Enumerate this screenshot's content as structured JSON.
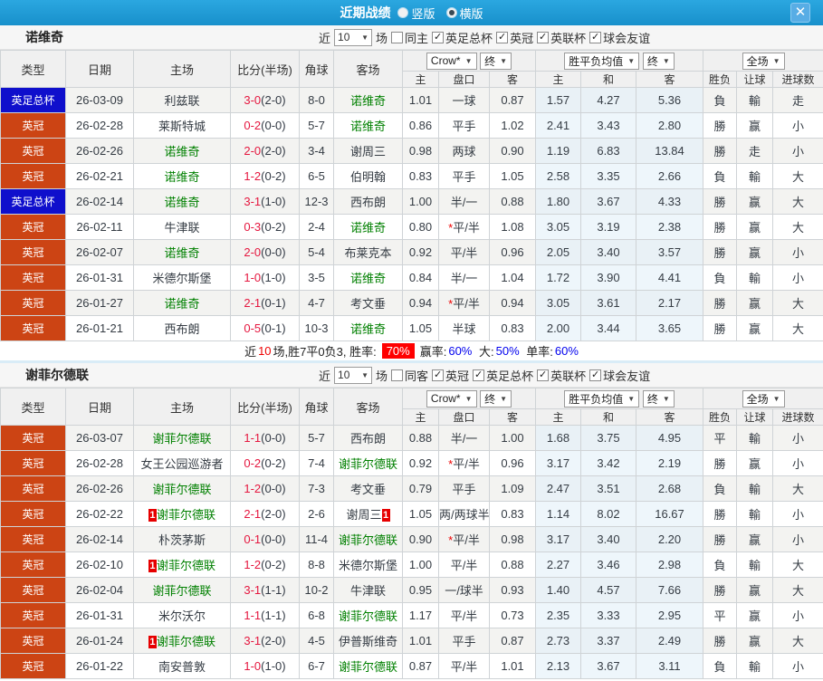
{
  "icons": {
    "dropdown_arrow": "▼",
    "close": "✕",
    "check": "✓"
  },
  "titlebar": {
    "title": "近期战绩",
    "radio_vertical": "竖版",
    "radio_horizontal": "横版"
  },
  "table_header": {
    "type": "类型",
    "date": "日期",
    "home": "主场",
    "score": "比分(半场)",
    "corner": "角球",
    "away": "客场",
    "h_home": "主",
    "h_handicap": "盘口",
    "h_away": "客",
    "o_home": "主",
    "o_draw": "和",
    "o_away": "客",
    "res_wl": "胜负",
    "res_handicap": "让球",
    "res_goals": "进球数"
  },
  "sections": [
    {
      "team": "诺维奇",
      "filter": {
        "near": "近",
        "count": "10",
        "games": "场",
        "same": "同主",
        "comps": [
          "英足总杯",
          "英冠",
          "英联杯",
          "球会友谊"
        ]
      },
      "dropdowns": {
        "book": "Crow*",
        "final1": "终",
        "avg": "胜平负均值",
        "final2": "终",
        "scope": "全场"
      },
      "rows": [
        {
          "type": "英足总杯",
          "tc": "cup",
          "date": "26-03-09",
          "hcard": "",
          "home": "利兹联",
          "hcls": "plain",
          "score": "3-0",
          "half": "(2-0)",
          "corner": "8-0",
          "away": "诺维奇",
          "acls": "team",
          "acard": "",
          "hw": "1.01",
          "star": "",
          "hd": "一球",
          "ha": "0.87",
          "oh": "1.57",
          "od": "4.27",
          "oa": "5.36",
          "r1": "負",
          "c1": "g",
          "r2": "輸",
          "c2": "g",
          "r3": "走",
          "c3": "b"
        },
        {
          "type": "英冠",
          "tc": "league",
          "date": "26-02-28",
          "hcard": "",
          "home": "莱斯特城",
          "hcls": "plain",
          "score": "0-2",
          "half": "(0-0)",
          "corner": "5-7",
          "away": "诺维奇",
          "acls": "team",
          "acard": "",
          "hw": "0.86",
          "star": "",
          "hd": "平手",
          "ha": "1.02",
          "oh": "2.41",
          "od": "3.43",
          "oa": "2.80",
          "r1": "勝",
          "c1": "r",
          "r2": "赢",
          "c2": "r",
          "r3": "小",
          "c3": "g"
        },
        {
          "type": "英冠",
          "tc": "league",
          "date": "26-02-26",
          "hcard": "",
          "home": "诺维奇",
          "hcls": "team",
          "score": "2-0",
          "half": "(2-0)",
          "corner": "3-4",
          "away": "谢周三",
          "acls": "plain",
          "acard": "",
          "hw": "0.98",
          "star": "",
          "hd": "两球",
          "ha": "0.90",
          "oh": "1.19",
          "od": "6.83",
          "oa": "13.84",
          "r1": "勝",
          "c1": "r",
          "r2": "走",
          "c2": "b",
          "r3": "小",
          "c3": "g"
        },
        {
          "type": "英冠",
          "tc": "league",
          "date": "26-02-21",
          "hcard": "",
          "home": "诺维奇",
          "hcls": "team",
          "score": "1-2",
          "half": "(0-2)",
          "corner": "6-5",
          "away": "伯明翰",
          "acls": "plain",
          "acard": "",
          "hw": "0.83",
          "star": "",
          "hd": "平手",
          "ha": "1.05",
          "oh": "2.58",
          "od": "3.35",
          "oa": "2.66",
          "r1": "負",
          "c1": "g",
          "r2": "輸",
          "c2": "g",
          "r3": "大",
          "c3": "r"
        },
        {
          "type": "英足总杯",
          "tc": "cup",
          "date": "26-02-14",
          "hcard": "",
          "home": "诺维奇",
          "hcls": "team",
          "score": "3-1",
          "half": "(1-0)",
          "corner": "12-3",
          "away": "西布朗",
          "acls": "plain",
          "acard": "",
          "hw": "1.00",
          "star": "",
          "hd": "半/一",
          "ha": "0.88",
          "oh": "1.80",
          "od": "3.67",
          "oa": "4.33",
          "r1": "勝",
          "c1": "r",
          "r2": "赢",
          "c2": "r",
          "r3": "大",
          "c3": "r"
        },
        {
          "type": "英冠",
          "tc": "league",
          "date": "26-02-11",
          "hcard": "",
          "home": "牛津联",
          "hcls": "plain",
          "score": "0-3",
          "half": "(0-2)",
          "corner": "2-4",
          "away": "诺维奇",
          "acls": "team",
          "acard": "",
          "hw": "0.80",
          "star": "*",
          "hd": "平/半",
          "ha": "1.08",
          "oh": "3.05",
          "od": "3.19",
          "oa": "2.38",
          "r1": "勝",
          "c1": "r",
          "r2": "赢",
          "c2": "r",
          "r3": "大",
          "c3": "r"
        },
        {
          "type": "英冠",
          "tc": "league",
          "date": "26-02-07",
          "hcard": "",
          "home": "诺维奇",
          "hcls": "team",
          "score": "2-0",
          "half": "(0-0)",
          "corner": "5-4",
          "away": "布莱克本",
          "acls": "plain",
          "acard": "",
          "hw": "0.92",
          "star": "",
          "hd": "平/半",
          "ha": "0.96",
          "oh": "2.05",
          "od": "3.40",
          "oa": "3.57",
          "r1": "勝",
          "c1": "r",
          "r2": "赢",
          "c2": "r",
          "r3": "小",
          "c3": "g"
        },
        {
          "type": "英冠",
          "tc": "league",
          "date": "26-01-31",
          "hcard": "",
          "home": "米德尔斯堡",
          "hcls": "plain",
          "score": "1-0",
          "half": "(1-0)",
          "corner": "3-5",
          "away": "诺维奇",
          "acls": "team",
          "acard": "",
          "hw": "0.84",
          "star": "",
          "hd": "半/一",
          "ha": "1.04",
          "oh": "1.72",
          "od": "3.90",
          "oa": "4.41",
          "r1": "負",
          "c1": "g",
          "r2": "輸",
          "c2": "g",
          "r3": "小",
          "c3": "g"
        },
        {
          "type": "英冠",
          "tc": "league",
          "date": "26-01-27",
          "hcard": "",
          "home": "诺维奇",
          "hcls": "team",
          "score": "2-1",
          "half": "(0-1)",
          "corner": "4-7",
          "away": "考文垂",
          "acls": "plain",
          "acard": "",
          "hw": "0.94",
          "star": "*",
          "hd": "平/半",
          "ha": "0.94",
          "oh": "3.05",
          "od": "3.61",
          "oa": "2.17",
          "r1": "勝",
          "c1": "r",
          "r2": "赢",
          "c2": "r",
          "r3": "大",
          "c3": "r"
        },
        {
          "type": "英冠",
          "tc": "league",
          "date": "26-01-21",
          "hcard": "",
          "home": "西布朗",
          "hcls": "plain",
          "score": "0-5",
          "half": "(0-1)",
          "corner": "10-3",
          "away": "诺维奇",
          "acls": "team",
          "acard": "",
          "hw": "1.05",
          "star": "",
          "hd": "半球",
          "ha": "0.83",
          "oh": "2.00",
          "od": "3.44",
          "oa": "3.65",
          "r1": "勝",
          "c1": "r",
          "r2": "赢",
          "c2": "r",
          "r3": "大",
          "c3": "r"
        }
      ],
      "summary": {
        "t1": "近",
        "t2": "10",
        "t3": "场,胜7平0负3, 胜率:",
        "rate": "70%",
        "t4": "赢率:",
        "v4": "60%",
        "t5": "大:",
        "v5": "50%",
        "t6": "单率:",
        "v6": "60%"
      }
    },
    {
      "team": "谢菲尔德联",
      "filter": {
        "near": "近",
        "count": "10",
        "games": "场",
        "same": "同客",
        "comps": [
          "英冠",
          "英足总杯",
          "英联杯",
          "球会友谊"
        ]
      },
      "dropdowns": {
        "book": "Crow*",
        "final1": "终",
        "avg": "胜平负均值",
        "final2": "终",
        "scope": "全场"
      },
      "rows": [
        {
          "type": "英冠",
          "tc": "league",
          "date": "26-03-07",
          "hcard": "",
          "home": "谢菲尔德联",
          "hcls": "team",
          "score": "1-1",
          "half": "(0-0)",
          "corner": "5-7",
          "away": "西布朗",
          "acls": "plain",
          "acard": "",
          "hw": "0.88",
          "star": "",
          "hd": "半/一",
          "ha": "1.00",
          "oh": "1.68",
          "od": "3.75",
          "oa": "4.95",
          "r1": "平",
          "c1": "b",
          "r2": "輸",
          "c2": "g",
          "r3": "小",
          "c3": "g"
        },
        {
          "type": "英冠",
          "tc": "league",
          "date": "26-02-28",
          "hcard": "",
          "home": "女王公园巡游者",
          "hcls": "plain",
          "score": "0-2",
          "half": "(0-2)",
          "corner": "7-4",
          "away": "谢菲尔德联",
          "acls": "team",
          "acard": "",
          "hw": "0.92",
          "star": "*",
          "hd": "平/半",
          "ha": "0.96",
          "oh": "3.17",
          "od": "3.42",
          "oa": "2.19",
          "r1": "勝",
          "c1": "r",
          "r2": "赢",
          "c2": "r",
          "r3": "小",
          "c3": "g"
        },
        {
          "type": "英冠",
          "tc": "league",
          "date": "26-02-26",
          "hcard": "",
          "home": "谢菲尔德联",
          "hcls": "team",
          "score": "1-2",
          "half": "(0-0)",
          "corner": "7-3",
          "away": "考文垂",
          "acls": "plain",
          "acard": "",
          "hw": "0.79",
          "star": "",
          "hd": "平手",
          "ha": "1.09",
          "oh": "2.47",
          "od": "3.51",
          "oa": "2.68",
          "r1": "負",
          "c1": "g",
          "r2": "輸",
          "c2": "g",
          "r3": "大",
          "c3": "r"
        },
        {
          "type": "英冠",
          "tc": "league",
          "date": "26-02-22",
          "hcard": "1",
          "home": "谢菲尔德联",
          "hcls": "team",
          "score": "2-1",
          "half": "(2-0)",
          "corner": "2-6",
          "away": "谢周三",
          "acls": "plain",
          "acard": "1",
          "hw": "1.05",
          "star": "",
          "hd": "两/两球半",
          "ha": "0.83",
          "oh": "1.14",
          "od": "8.02",
          "oa": "16.67",
          "r1": "勝",
          "c1": "r",
          "r2": "輸",
          "c2": "g",
          "r3": "小",
          "c3": "g"
        },
        {
          "type": "英冠",
          "tc": "league",
          "date": "26-02-14",
          "hcard": "",
          "home": "朴茨茅斯",
          "hcls": "plain",
          "score": "0-1",
          "half": "(0-0)",
          "corner": "11-4",
          "away": "谢菲尔德联",
          "acls": "team",
          "acard": "",
          "hw": "0.90",
          "star": "*",
          "hd": "平/半",
          "ha": "0.98",
          "oh": "3.17",
          "od": "3.40",
          "oa": "2.20",
          "r1": "勝",
          "c1": "r",
          "r2": "赢",
          "c2": "r",
          "r3": "小",
          "c3": "g"
        },
        {
          "type": "英冠",
          "tc": "league",
          "date": "26-02-10",
          "hcard": "1",
          "home": "谢菲尔德联",
          "hcls": "team",
          "score": "1-2",
          "half": "(0-2)",
          "corner": "8-8",
          "away": "米德尔斯堡",
          "acls": "plain",
          "acard": "",
          "hw": "1.00",
          "star": "",
          "hd": "平/半",
          "ha": "0.88",
          "oh": "2.27",
          "od": "3.46",
          "oa": "2.98",
          "r1": "負",
          "c1": "g",
          "r2": "輸",
          "c2": "g",
          "r3": "大",
          "c3": "r"
        },
        {
          "type": "英冠",
          "tc": "league",
          "date": "26-02-04",
          "hcard": "",
          "home": "谢菲尔德联",
          "hcls": "team",
          "score": "3-1",
          "half": "(1-1)",
          "corner": "10-2",
          "away": "牛津联",
          "acls": "plain",
          "acard": "",
          "hw": "0.95",
          "star": "",
          "hd": "一/球半",
          "ha": "0.93",
          "oh": "1.40",
          "od": "4.57",
          "oa": "7.66",
          "r1": "勝",
          "c1": "r",
          "r2": "赢",
          "c2": "r",
          "r3": "大",
          "c3": "r"
        },
        {
          "type": "英冠",
          "tc": "league",
          "date": "26-01-31",
          "hcard": "",
          "home": "米尔沃尔",
          "hcls": "plain",
          "score": "1-1",
          "half": "(1-1)",
          "corner": "6-8",
          "away": "谢菲尔德联",
          "acls": "team",
          "acard": "",
          "hw": "1.17",
          "star": "",
          "hd": "平/半",
          "ha": "0.73",
          "oh": "2.35",
          "od": "3.33",
          "oa": "2.95",
          "r1": "平",
          "c1": "b",
          "r2": "赢",
          "c2": "r",
          "r3": "小",
          "c3": "g"
        },
        {
          "type": "英冠",
          "tc": "league",
          "date": "26-01-24",
          "hcard": "1",
          "home": "谢菲尔德联",
          "hcls": "team",
          "score": "3-1",
          "half": "(2-0)",
          "corner": "4-5",
          "away": "伊普斯维奇",
          "acls": "plain",
          "acard": "",
          "hw": "1.01",
          "star": "",
          "hd": "平手",
          "ha": "0.87",
          "oh": "2.73",
          "od": "3.37",
          "oa": "2.49",
          "r1": "勝",
          "c1": "r",
          "r2": "赢",
          "c2": "r",
          "r3": "大",
          "c3": "r"
        },
        {
          "type": "英冠",
          "tc": "league",
          "date": "26-01-22",
          "hcard": "",
          "home": "南安普敦",
          "hcls": "plain",
          "score": "1-0",
          "half": "(1-0)",
          "corner": "6-7",
          "away": "谢菲尔德联",
          "acls": "team",
          "acard": "",
          "hw": "0.87",
          "star": "",
          "hd": "平/半",
          "ha": "1.01",
          "oh": "2.13",
          "od": "3.67",
          "oa": "3.11",
          "r1": "負",
          "c1": "g",
          "r2": "輸",
          "c2": "g",
          "r3": "小",
          "c3": "g"
        }
      ]
    }
  ]
}
